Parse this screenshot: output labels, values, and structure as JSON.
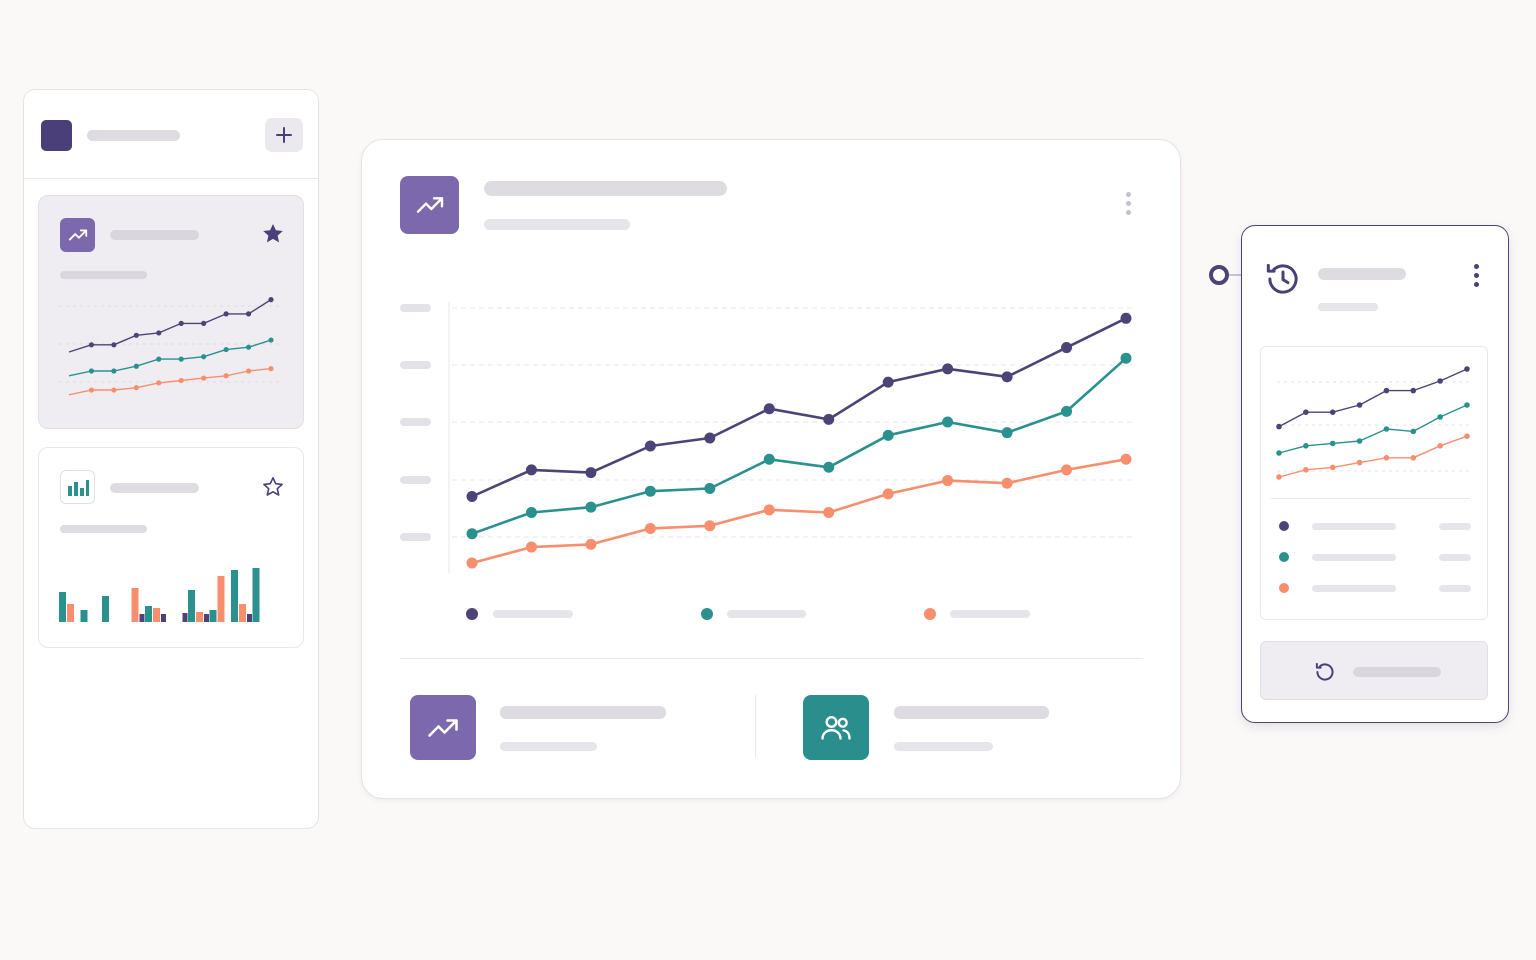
{
  "colors": {
    "brand": "#4a3f78",
    "purple": "#4e4377",
    "teal": "#2a918f",
    "coral": "#f78f6e",
    "accent_tile": "#7c69ad",
    "teal_tile": "#2a8f8c"
  },
  "sidebar": {
    "logo_icon": "app-logo-square",
    "add_icon": "plus-icon",
    "cards": [
      {
        "icon": "trend-icon",
        "starred": true,
        "star_icon": "star-filled-icon",
        "chart_data": {
          "type": "line",
          "x": [
            1,
            2,
            3,
            4,
            5,
            6,
            7,
            8,
            9,
            10
          ],
          "series": [
            {
              "values": [
                58,
                61,
                61,
                65,
                66,
                70,
                70,
                74,
                74,
                80
              ]
            },
            {
              "values": [
                48,
                50,
                50,
                52,
                55,
                55,
                56,
                59,
                60,
                63
              ]
            },
            {
              "values": [
                40,
                42,
                42,
                43,
                45,
                46,
                47,
                48,
                50,
                51
              ]
            }
          ]
        }
      },
      {
        "icon": "bar-chart-icon",
        "starred": false,
        "star_icon": "star-outline-icon",
        "chart_data": {
          "type": "bar",
          "groups": [
            {
              "teal": 30,
              "coral": 18,
              "purple": 0
            },
            {
              "teal": 12,
              "coral": 0,
              "purple": 0
            },
            {
              "teal": 26,
              "coral": 0,
              "purple": 0
            },
            {
              "teal": 0,
              "coral": 34,
              "purple": 8
            },
            {
              "teal": 16,
              "coral": 14,
              "purple": 8
            },
            {
              "teal": 0,
              "coral": 0,
              "purple": 9
            },
            {
              "teal": 32,
              "coral": 10,
              "purple": 8
            },
            {
              "teal": 12,
              "coral": 46,
              "purple": 0
            },
            {
              "teal": 52,
              "coral": 18,
              "purple": 8
            },
            {
              "teal": 54,
              "coral": 0,
              "purple": 0
            }
          ]
        }
      }
    ]
  },
  "main": {
    "header_icon": "trend-icon",
    "menu_icon": "kebab-menu-icon",
    "chart_data": {
      "type": "line",
      "x": [
        1,
        2,
        3,
        4,
        5,
        6,
        7,
        8,
        9,
        10,
        11,
        12
      ],
      "ylim": [
        0,
        100
      ],
      "grid": true,
      "series": [
        {
          "color": "purple",
          "values": [
            28,
            38,
            37,
            47,
            50,
            61,
            57,
            71,
            76,
            73,
            84,
            95
          ]
        },
        {
          "color": "teal",
          "values": [
            14,
            22,
            24,
            30,
            31,
            42,
            39,
            51,
            56,
            52,
            60,
            80
          ]
        },
        {
          "color": "coral",
          "values": [
            3,
            9,
            10,
            16,
            17,
            23,
            22,
            29,
            34,
            33,
            38,
            42
          ]
        }
      ],
      "legend_position": "bottom"
    },
    "stats": [
      {
        "icon": "trend-icon",
        "color": "accent_tile"
      },
      {
        "icon": "users-icon",
        "color": "teal_tile"
      }
    ]
  },
  "history": {
    "icon": "history-clock-icon",
    "menu_icon": "kebab-menu-icon",
    "connector_icon": "connector-ring-icon",
    "chart_data": {
      "type": "line",
      "x": [
        1,
        2,
        3,
        4,
        5,
        6,
        7,
        8
      ],
      "series": [
        {
          "values": [
            56,
            62,
            62,
            65,
            71,
            71,
            75,
            80
          ]
        },
        {
          "values": [
            45,
            48,
            49,
            50,
            55,
            54,
            60,
            65
          ]
        },
        {
          "values": [
            35,
            38,
            39,
            41,
            43,
            43,
            48,
            52
          ]
        }
      ]
    },
    "restore_icon": "restore-icon"
  }
}
